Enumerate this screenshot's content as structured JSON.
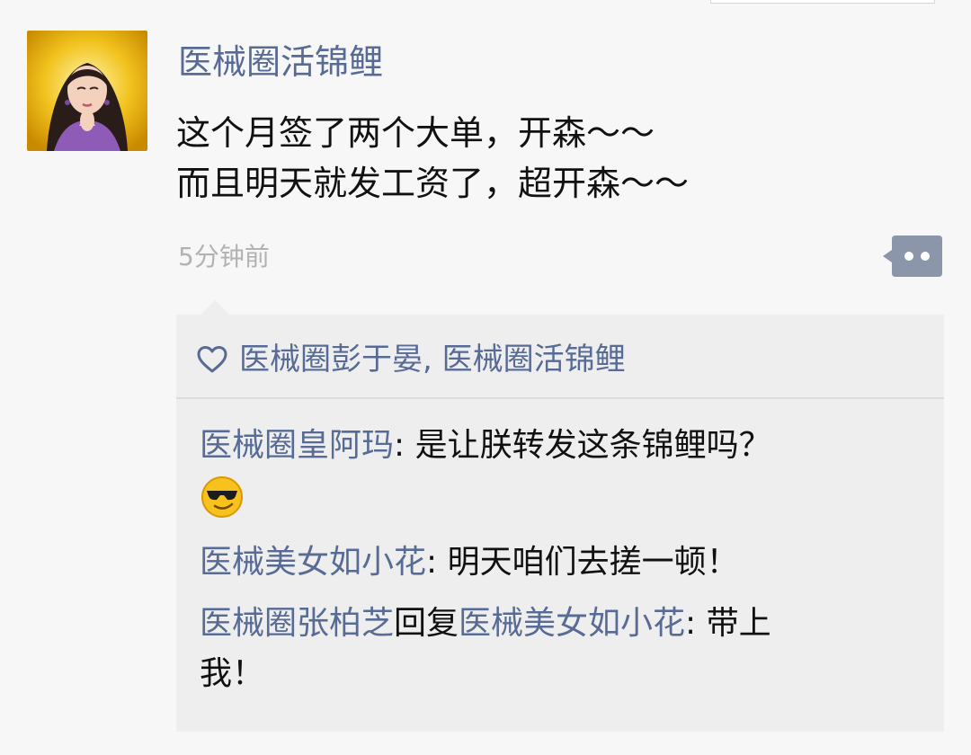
{
  "post": {
    "author": "医械圈活锦鲤",
    "text_lines": [
      "这个月签了两个大单，开森～～",
      "而且明天就发工资了，超开森～～"
    ],
    "time": "5分钟前"
  },
  "likes": {
    "names_text": "医械圈彭于晏, 医械圈活锦鲤"
  },
  "comments": [
    {
      "name": "医械圈皇阿玛",
      "separator": ": ",
      "text": "是让朕转发这条锦鲤吗？",
      "emoji": "cool-smiley"
    },
    {
      "name": "医械美女如小花",
      "separator": ": ",
      "text": "明天咱们去搓一顿！"
    },
    {
      "name": "医械圈张柏芝",
      "reply_word": "回复",
      "reply_to": "医械美女如小花",
      "separator": ": ",
      "text_line1": "带上",
      "text_line2": "我！"
    }
  ],
  "colors": {
    "link": "#576b95",
    "text": "#111111",
    "time": "#b2b2b2",
    "panel_bg": "#eeeeee"
  }
}
